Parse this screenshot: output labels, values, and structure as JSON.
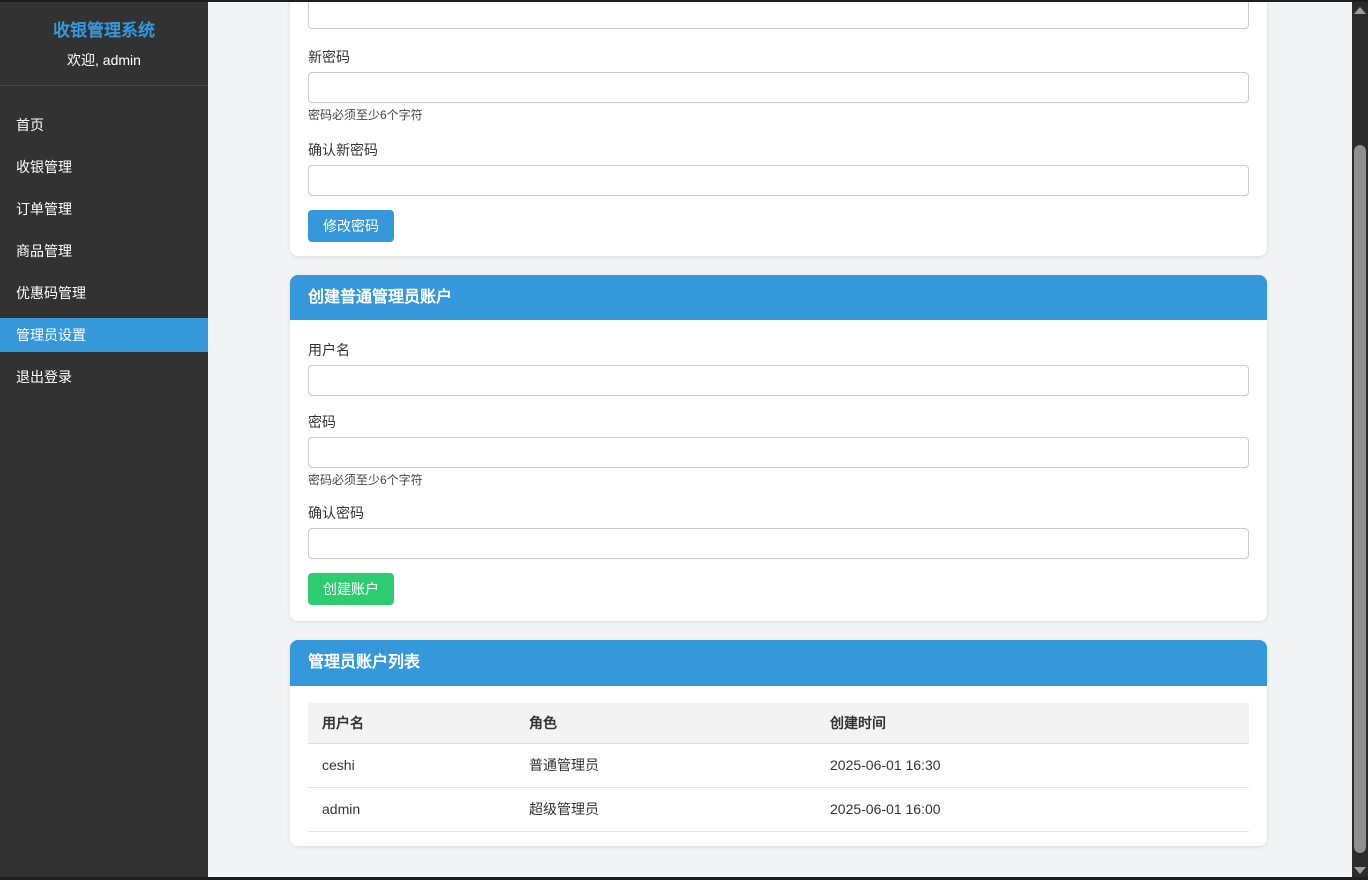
{
  "colors": {
    "accent_blue": "#3498db",
    "accent_green": "#2ecc71",
    "sidebar_bg": "#323232"
  },
  "app": {
    "title": "收银管理系统",
    "welcome": "欢迎, admin"
  },
  "sidebar": {
    "items": [
      {
        "label": "首页",
        "active": false
      },
      {
        "label": "收银管理",
        "active": false
      },
      {
        "label": "订单管理",
        "active": false
      },
      {
        "label": "商品管理",
        "active": false
      },
      {
        "label": "优惠码管理",
        "active": false
      },
      {
        "label": "管理员设置",
        "active": true
      },
      {
        "label": "退出登录",
        "active": false
      }
    ]
  },
  "password_panel": {
    "current_password_value": "",
    "new_password_label": "新密码",
    "new_password_value": "",
    "password_hint": "密码必须至少6个字符",
    "confirm_new_password_label": "确认新密码",
    "confirm_new_password_value": "",
    "submit_label": "修改密码"
  },
  "create_admin_panel": {
    "title": "创建普通管理员账户",
    "username_label": "用户名",
    "username_value": "",
    "password_label": "密码",
    "password_value": "",
    "password_hint": "密码必须至少6个字符",
    "confirm_password_label": "确认密码",
    "confirm_password_value": "",
    "submit_label": "创建账户"
  },
  "admin_list_panel": {
    "title": "管理员账户列表",
    "columns": [
      "用户名",
      "角色",
      "创建时间"
    ],
    "rows": [
      {
        "username": "ceshi",
        "role": "普通管理员",
        "created_at": "2025-06-01 16:30"
      },
      {
        "username": "admin",
        "role": "超级管理员",
        "created_at": "2025-06-01 16:00"
      }
    ]
  }
}
